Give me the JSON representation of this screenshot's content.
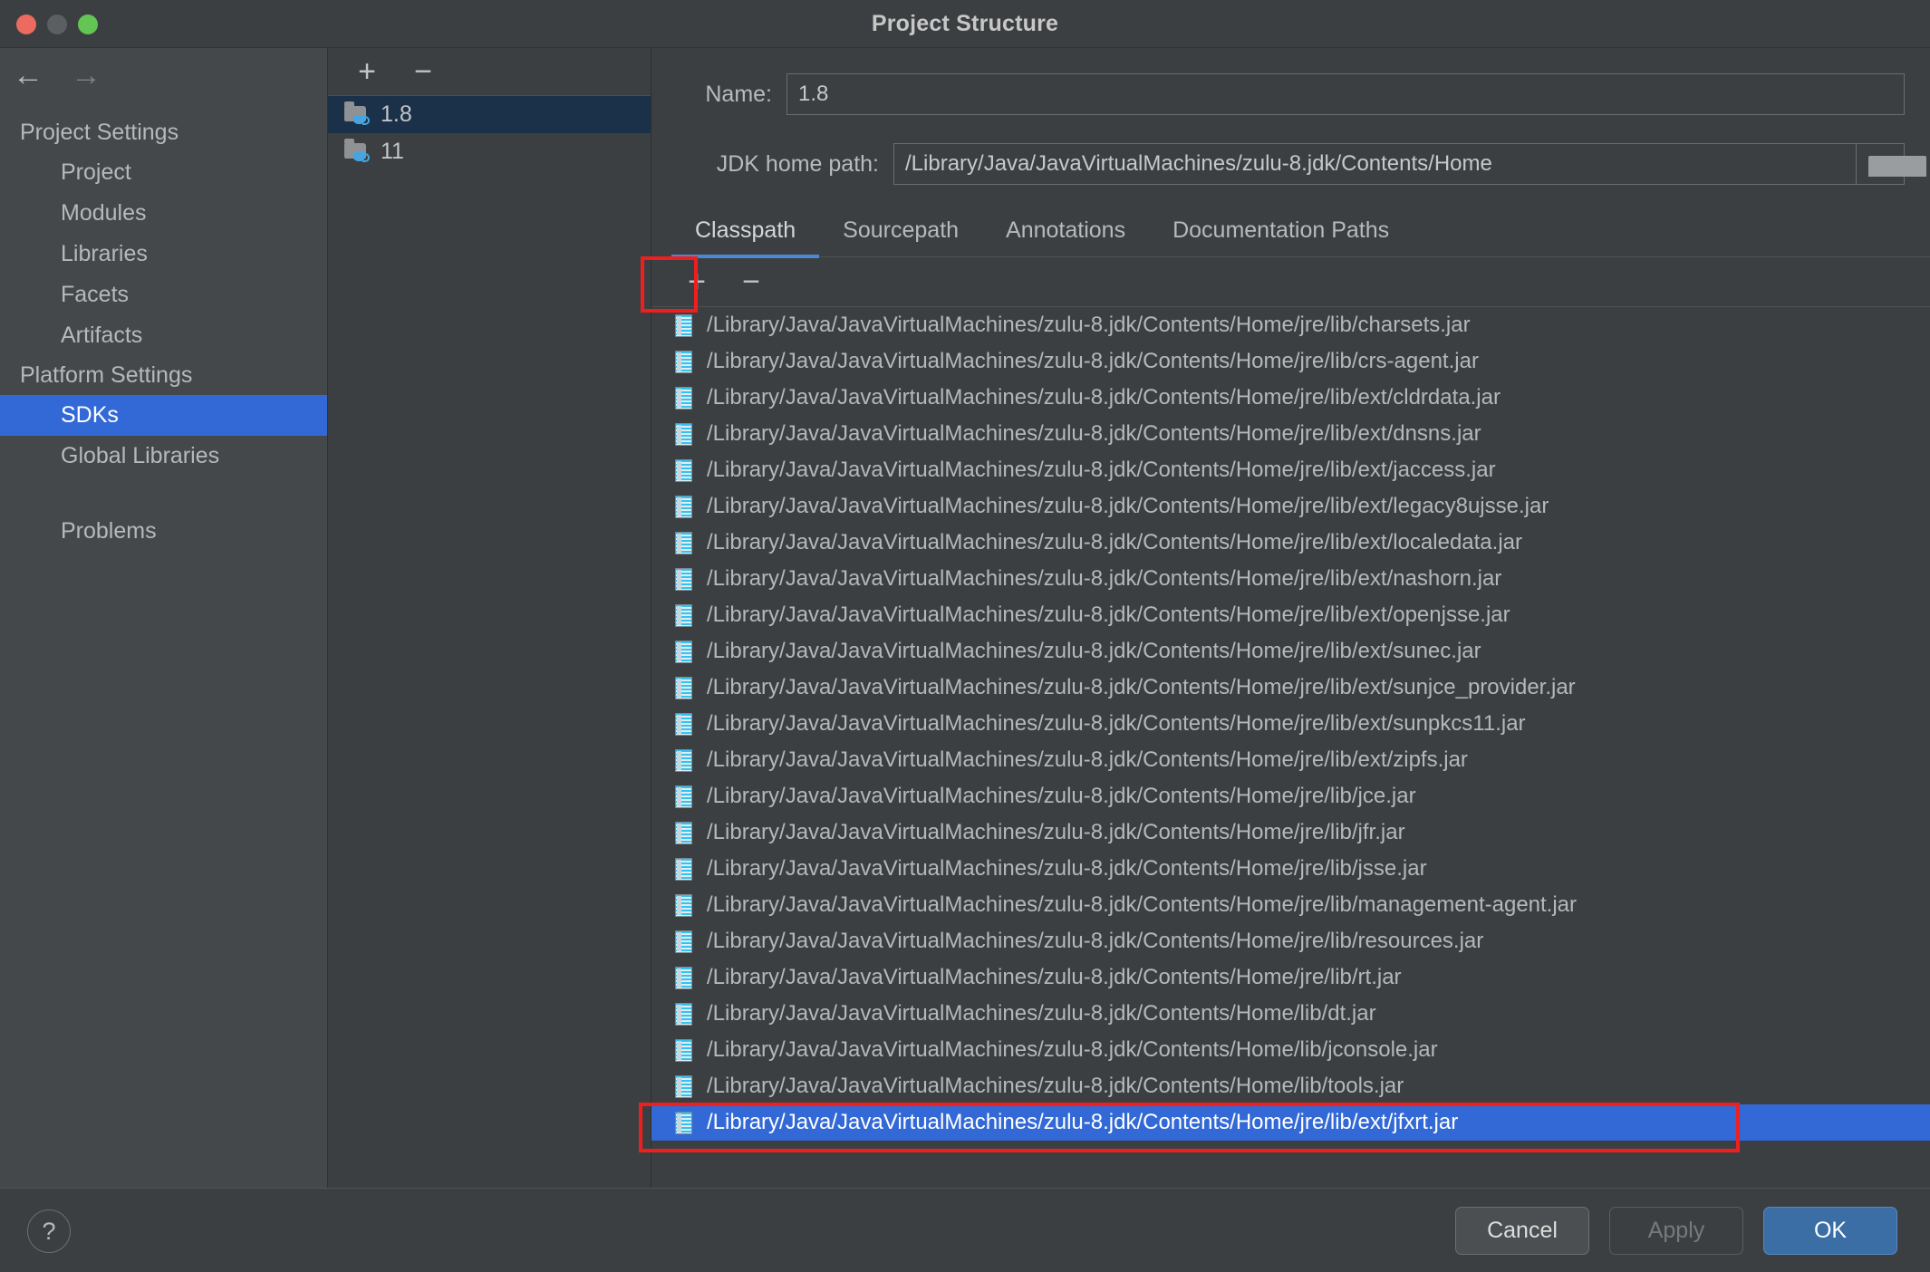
{
  "window": {
    "title": "Project Structure",
    "traffic_lights": [
      "close-red",
      "minimize-yellow",
      "maximize-green"
    ]
  },
  "nav": {
    "back_icon": "←",
    "forward_icon": "→"
  },
  "sidebar": {
    "groups": [
      {
        "label": "Project Settings",
        "items": [
          "Project",
          "Modules",
          "Libraries",
          "Facets",
          "Artifacts"
        ]
      },
      {
        "label": "Platform Settings",
        "items": [
          "SDKs",
          "Global Libraries"
        ]
      }
    ],
    "group_project_settings": "Project Settings",
    "group_platform_settings": "Platform Settings",
    "item_project": "Project",
    "item_modules": "Modules",
    "item_libraries": "Libraries",
    "item_facets": "Facets",
    "item_artifacts": "Artifacts",
    "item_sdks": "SDKs",
    "item_global_libraries": "Global Libraries",
    "item_problems": "Problems",
    "selected": "SDKs",
    "selected_color": "#3369d6"
  },
  "sdk_list": {
    "add_label": "+",
    "remove_label": "−",
    "items": [
      {
        "name": "1.8",
        "selected": true
      },
      {
        "name": "11",
        "selected": false
      }
    ],
    "item_0_name": "1.8",
    "item_1_name": "11",
    "selected_bg": "#1b3049"
  },
  "detail": {
    "name_label": "Name:",
    "name_value": "1.8",
    "path_label": "JDK home path:",
    "path_value": "/Library/Java/JavaVirtualMachines/zulu-8.jdk/Contents/Home",
    "browse_icon": "folder-icon"
  },
  "tabs": {
    "items": [
      "Classpath",
      "Sourcepath",
      "Annotations",
      "Documentation Paths"
    ],
    "tab_classpath": "Classpath",
    "tab_sourcepath": "Sourcepath",
    "tab_annotations": "Annotations",
    "tab_documentation_paths": "Documentation Paths",
    "active": "Classpath",
    "underline_color": "#4a88d6"
  },
  "classpath_toolbar": {
    "add_label": "+",
    "remove_label": "−",
    "add_highlighted": true,
    "highlight_color": "#f01f1f"
  },
  "classpath": {
    "entries": [
      "/Library/Java/JavaVirtualMachines/zulu-8.jdk/Contents/Home/jre/lib/charsets.jar",
      "/Library/Java/JavaVirtualMachines/zulu-8.jdk/Contents/Home/jre/lib/crs-agent.jar",
      "/Library/Java/JavaVirtualMachines/zulu-8.jdk/Contents/Home/jre/lib/ext/cldrdata.jar",
      "/Library/Java/JavaVirtualMachines/zulu-8.jdk/Contents/Home/jre/lib/ext/dnsns.jar",
      "/Library/Java/JavaVirtualMachines/zulu-8.jdk/Contents/Home/jre/lib/ext/jaccess.jar",
      "/Library/Java/JavaVirtualMachines/zulu-8.jdk/Contents/Home/jre/lib/ext/legacy8ujsse.jar",
      "/Library/Java/JavaVirtualMachines/zulu-8.jdk/Contents/Home/jre/lib/ext/localedata.jar",
      "/Library/Java/JavaVirtualMachines/zulu-8.jdk/Contents/Home/jre/lib/ext/nashorn.jar",
      "/Library/Java/JavaVirtualMachines/zulu-8.jdk/Contents/Home/jre/lib/ext/openjsse.jar",
      "/Library/Java/JavaVirtualMachines/zulu-8.jdk/Contents/Home/jre/lib/ext/sunec.jar",
      "/Library/Java/JavaVirtualMachines/zulu-8.jdk/Contents/Home/jre/lib/ext/sunjce_provider.jar",
      "/Library/Java/JavaVirtualMachines/zulu-8.jdk/Contents/Home/jre/lib/ext/sunpkcs11.jar",
      "/Library/Java/JavaVirtualMachines/zulu-8.jdk/Contents/Home/jre/lib/ext/zipfs.jar",
      "/Library/Java/JavaVirtualMachines/zulu-8.jdk/Contents/Home/jre/lib/jce.jar",
      "/Library/Java/JavaVirtualMachines/zulu-8.jdk/Contents/Home/jre/lib/jfr.jar",
      "/Library/Java/JavaVirtualMachines/zulu-8.jdk/Contents/Home/jre/lib/jsse.jar",
      "/Library/Java/JavaVirtualMachines/zulu-8.jdk/Contents/Home/jre/lib/management-agent.jar",
      "/Library/Java/JavaVirtualMachines/zulu-8.jdk/Contents/Home/jre/lib/resources.jar",
      "/Library/Java/JavaVirtualMachines/zulu-8.jdk/Contents/Home/jre/lib/rt.jar",
      "/Library/Java/JavaVirtualMachines/zulu-8.jdk/Contents/Home/lib/dt.jar",
      "/Library/Java/JavaVirtualMachines/zulu-8.jdk/Contents/Home/lib/jconsole.jar",
      "/Library/Java/JavaVirtualMachines/zulu-8.jdk/Contents/Home/lib/tools.jar",
      "/Library/Java/JavaVirtualMachines/zulu-8.jdk/Contents/Home/jre/lib/ext/jfxrt.jar"
    ],
    "selected_index": 22,
    "selected_value": "/Library/Java/JavaVirtualMachines/zulu-8.jdk/Contents/Home/jre/lib/ext/jfxrt.jar",
    "selected_bg": "#3369d6",
    "selected_highlighted": true
  },
  "footer": {
    "help_label": "?",
    "cancel_label": "Cancel",
    "apply_label": "Apply",
    "apply_disabled": true,
    "ok_label": "OK",
    "ok_color": "#3a6ea5"
  }
}
